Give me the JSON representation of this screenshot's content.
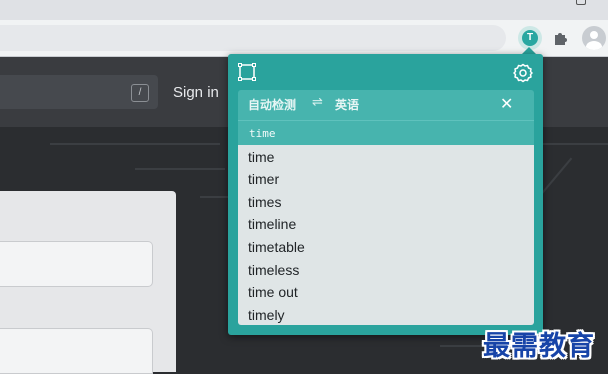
{
  "page": {
    "search_key_hint": "/",
    "sign_in_label": "Sign in"
  },
  "translator": {
    "source_lang": "自动检测",
    "swap_symbol": "⇌",
    "target_lang": "英语",
    "close_symbol": "✕",
    "query": "time",
    "suggestions": [
      "time",
      "timer",
      "times",
      "timeline",
      "timetable",
      "timeless",
      "time out",
      "timely"
    ]
  },
  "watermark": "最需教育",
  "colors": {
    "popup_teal": "#2aa39d",
    "list_bg": "#dfe5e6",
    "page_dark": "#2b2d30",
    "watermark_blue": "#1744a8"
  },
  "icons": {
    "extension": "translate-extension-icon",
    "puzzle": "puzzle-icon",
    "profile": "profile-icon",
    "screenshot": "screenshot-frame-icon",
    "settings": "gear-icon",
    "swap": "swap-icon",
    "close": "close-icon"
  }
}
